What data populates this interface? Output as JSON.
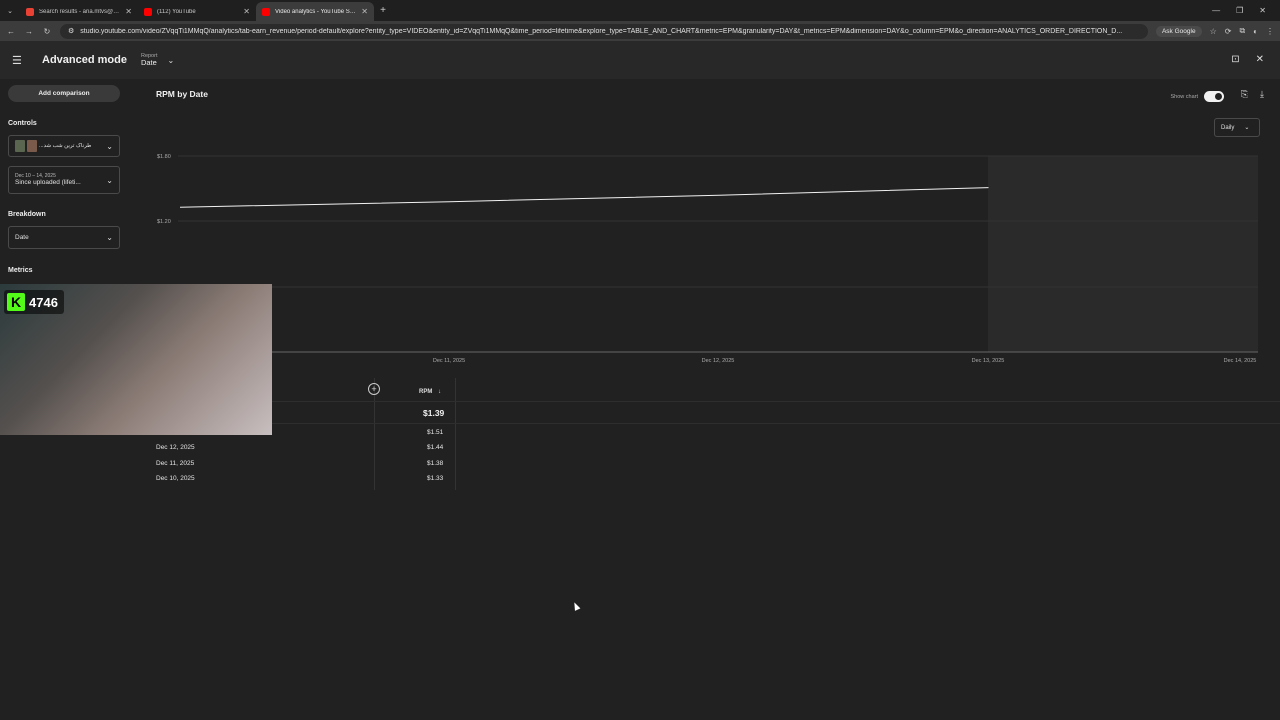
{
  "browser": {
    "tabs": [
      {
        "title": "Search results - aria.mtvs@gm...",
        "color": "#e94235"
      },
      {
        "title": "(112) YouTube",
        "color": "#ff0000"
      },
      {
        "title": "Video analytics - YouTube Studio",
        "color": "#ff0000"
      }
    ],
    "url": "studio.youtube.com/video/ZVqqTi1MMqQ/analytics/tab-earn_revenue/period-default/explore?entity_type=VIDEO&entity_id=ZVqqTi1MMqQ&time_period=lifetime&explore_type=TABLE_AND_CHART&metric=EPM&granularity=DAY&t_metrics=EPM&dimension=DAY&o_column=EPM&o_direction=ANALYTICS_ORDER_DIRECTION_D...",
    "ask_google": "Ask Google"
  },
  "header": {
    "title": "Advanced mode",
    "report_label": "Report",
    "report_value": "Date"
  },
  "sidebar": {
    "add_comparison": "Add comparison",
    "controls_label": "Controls",
    "video_title": "...طرناک ترین شب شد",
    "date_range_small": "Dec 10 – 14, 2025",
    "date_range": "Since uploaded (lifeti...",
    "breakdown_label": "Breakdown",
    "breakdown_value": "Date",
    "metrics_label": "Metrics"
  },
  "chart": {
    "title": "RPM by Date",
    "show_chart": "Show chart",
    "granularity": "Daily"
  },
  "chart_data": {
    "type": "line",
    "x": [
      "Dec 10, 2025",
      "Dec 11, 2025",
      "Dec 12, 2025",
      "Dec 13, 2025"
    ],
    "x_tick_labels": [
      "Dec 11, 2025",
      "Dec 12, 2025",
      "Dec 13, 2025",
      "Dec 14, 2025"
    ],
    "y_tick_labels": [
      "$1.80",
      "$1.20"
    ],
    "series": [
      {
        "values": [
          1.33,
          1.38,
          1.44,
          1.51
        ]
      }
    ],
    "ylim": [
      0,
      1.8
    ],
    "grid": true,
    "line_color": "#f1f1f1"
  },
  "overlay": {
    "kick_count": "4746",
    "kick_color": "#53fc18"
  },
  "table": {
    "column": "RPM",
    "total": "$1.39",
    "rows": [
      {
        "date": "",
        "value": "$1.51"
      },
      {
        "date": "Dec 12, 2025",
        "value": "$1.44"
      },
      {
        "date": "Dec 11, 2025",
        "value": "$1.38"
      },
      {
        "date": "Dec 10, 2025",
        "value": "$1.33"
      }
    ]
  }
}
